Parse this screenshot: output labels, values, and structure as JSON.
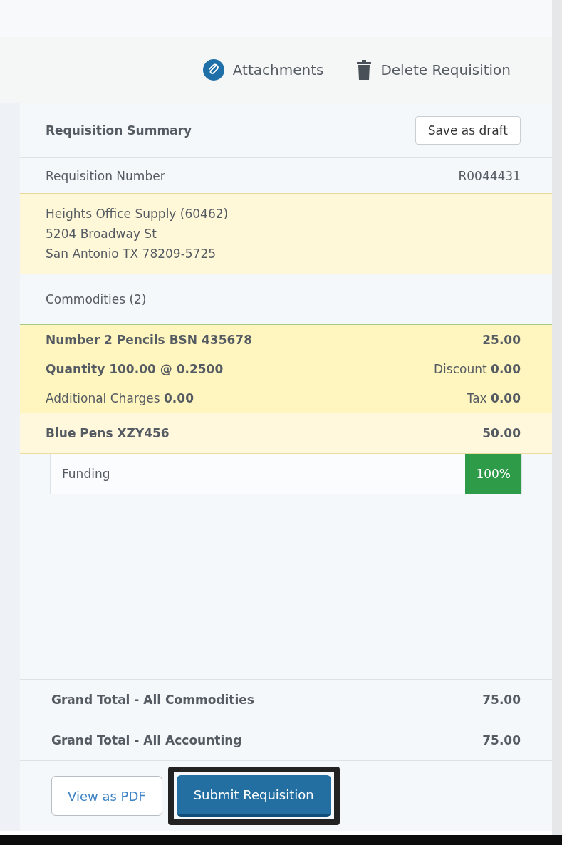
{
  "toolbar": {
    "attachments": "Attachments",
    "delete": "Delete Requisition"
  },
  "summary": {
    "title": "Requisition Summary",
    "save_button": "Save as draft"
  },
  "requisition": {
    "label": "Requisition Number",
    "value": "R0044431"
  },
  "supplier": {
    "lines": [
      "Heights Office Supply (60462)",
      "5204 Broadway St",
      "San Antonio TX 78209-5725"
    ]
  },
  "commodities": {
    "heading": "Commodities (2)",
    "items": [
      {
        "name": "Number 2 Pencils BSN 435678",
        "amount": "25.00",
        "selected": true,
        "quantity": "Quantity 100.00 @ 0.2500",
        "discount_label": "Discount",
        "discount": "0.00",
        "charges_label": "Additional Charges",
        "charges": "0.00",
        "tax_label": "Tax",
        "tax": "0.00"
      },
      {
        "name": "Blue Pens XZY456",
        "amount": "50.00",
        "selected": false
      }
    ]
  },
  "funding": {
    "label": "Funding",
    "value": "100%"
  },
  "totals": [
    {
      "label": "Grand Total - All Commodities",
      "value": "75.00"
    },
    {
      "label": "Grand Total - All Accounting",
      "value": "75.00"
    }
  ],
  "actions": {
    "pdf": "View as PDF",
    "submit": "Submit Requisition"
  }
}
